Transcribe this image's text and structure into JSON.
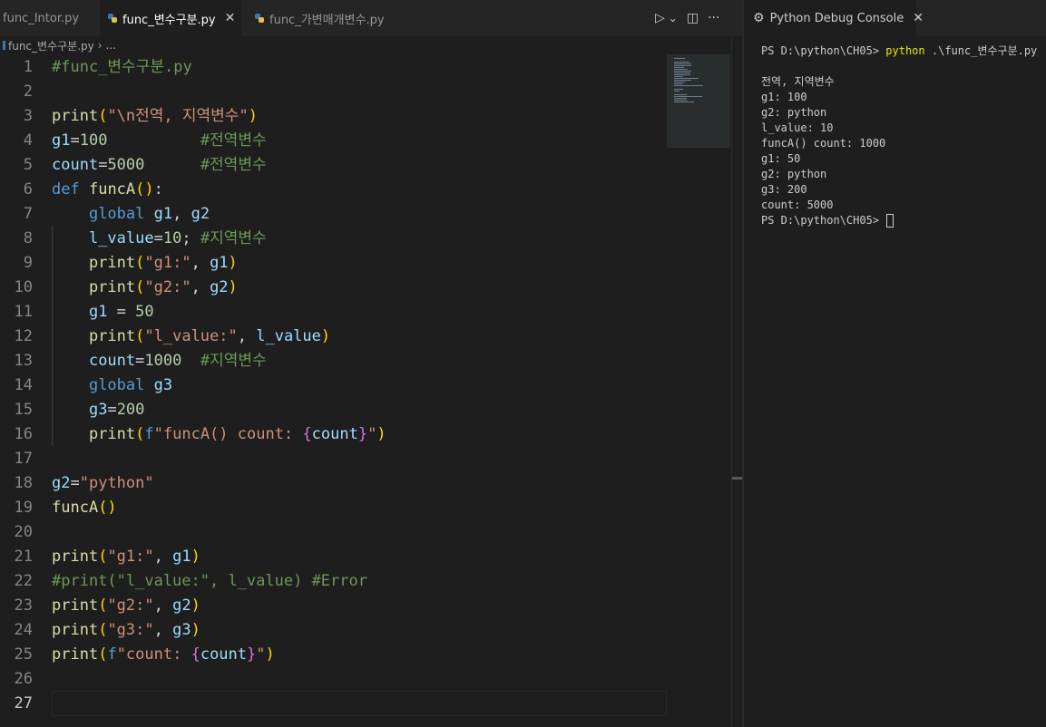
{
  "editor": {
    "tabs": [
      {
        "label": "func_Intor.py",
        "active": false
      },
      {
        "label": "func_변수구분.py",
        "active": true
      },
      {
        "label": "func_가변매개변수.py",
        "active": false
      }
    ],
    "actions": {
      "run": "▷",
      "run_dropdown": "⌄",
      "split": "◫",
      "more": "···"
    },
    "close_glyph": "✕",
    "breadcrumb": {
      "file": "func_변수구분.py",
      "sep": "›",
      "more": "..."
    },
    "current_line": 27
  },
  "panel": {
    "tab_label": "Python Debug Console",
    "close_glyph": "✕",
    "prompt": "PS D:\\python\\CH05>",
    "command": "python",
    "command_arg": ".\\func_변수구분.py",
    "output": [
      "",
      "전역, 지역변수",
      "g1: 100",
      "g2: python",
      "l_value: 10",
      "funcA() count: 1000",
      "g1: 50",
      "g2: python",
      "g3: 200",
      "count: 5000"
    ]
  },
  "colors": {
    "keyword": "#569cd6",
    "function": "#dcdcaa",
    "variable": "#9cdcfe",
    "number": "#b5cea8",
    "string": "#ce9178",
    "comment": "#6a9955",
    "bracket": "#ffd700",
    "bracket_nested": "#da70d6"
  },
  "code": [
    [
      {
        "t": "#func_변수구분.py",
        "c": "cmt"
      }
    ],
    [],
    [
      {
        "t": "print",
        "c": "fn"
      },
      {
        "t": "(",
        "c": "br"
      },
      {
        "t": "\"\\n전역, 지역변수\"",
        "c": "str"
      },
      {
        "t": ")",
        "c": "br"
      }
    ],
    [
      {
        "t": "g1",
        "c": "var"
      },
      {
        "t": "=",
        "c": "op"
      },
      {
        "t": "100",
        "c": "num"
      },
      {
        "t": "          ",
        "c": "op"
      },
      {
        "t": "#전역변수",
        "c": "cmt"
      }
    ],
    [
      {
        "t": "count",
        "c": "var"
      },
      {
        "t": "=",
        "c": "op"
      },
      {
        "t": "5000",
        "c": "num"
      },
      {
        "t": "      ",
        "c": "op"
      },
      {
        "t": "#전역변수",
        "c": "cmt"
      }
    ],
    [
      {
        "t": "def",
        "c": "kw"
      },
      {
        "t": " ",
        "c": "op"
      },
      {
        "t": "funcA",
        "c": "fn"
      },
      {
        "t": "()",
        "c": "br"
      },
      {
        "t": ":",
        "c": "op"
      }
    ],
    [
      {
        "t": "    ",
        "c": "op"
      },
      {
        "t": "global",
        "c": "kw"
      },
      {
        "t": " ",
        "c": "op"
      },
      {
        "t": "g1",
        "c": "var"
      },
      {
        "t": ", ",
        "c": "op"
      },
      {
        "t": "g2",
        "c": "var"
      }
    ],
    [
      {
        "t": "    ",
        "c": "op"
      },
      {
        "t": "l_value",
        "c": "var"
      },
      {
        "t": "=",
        "c": "op"
      },
      {
        "t": "10",
        "c": "num"
      },
      {
        "t": "; ",
        "c": "op"
      },
      {
        "t": "#지역변수",
        "c": "cmt"
      }
    ],
    [
      {
        "t": "    ",
        "c": "op"
      },
      {
        "t": "print",
        "c": "fn"
      },
      {
        "t": "(",
        "c": "br"
      },
      {
        "t": "\"g1:\"",
        "c": "str"
      },
      {
        "t": ", ",
        "c": "op"
      },
      {
        "t": "g1",
        "c": "var"
      },
      {
        "t": ")",
        "c": "br"
      }
    ],
    [
      {
        "t": "    ",
        "c": "op"
      },
      {
        "t": "print",
        "c": "fn"
      },
      {
        "t": "(",
        "c": "br"
      },
      {
        "t": "\"g2:\"",
        "c": "str"
      },
      {
        "t": ", ",
        "c": "op"
      },
      {
        "t": "g2",
        "c": "var"
      },
      {
        "t": ")",
        "c": "br"
      }
    ],
    [
      {
        "t": "    ",
        "c": "op"
      },
      {
        "t": "g1",
        "c": "var"
      },
      {
        "t": " = ",
        "c": "op"
      },
      {
        "t": "50",
        "c": "num"
      }
    ],
    [
      {
        "t": "    ",
        "c": "op"
      },
      {
        "t": "print",
        "c": "fn"
      },
      {
        "t": "(",
        "c": "br"
      },
      {
        "t": "\"l_value:\"",
        "c": "str"
      },
      {
        "t": ", ",
        "c": "op"
      },
      {
        "t": "l_value",
        "c": "var"
      },
      {
        "t": ")",
        "c": "br"
      }
    ],
    [
      {
        "t": "    ",
        "c": "op"
      },
      {
        "t": "count",
        "c": "var"
      },
      {
        "t": "=",
        "c": "op"
      },
      {
        "t": "1000",
        "c": "num"
      },
      {
        "t": "  ",
        "c": "op"
      },
      {
        "t": "#지역변수",
        "c": "cmt"
      }
    ],
    [
      {
        "t": "    ",
        "c": "op"
      },
      {
        "t": "global",
        "c": "kw"
      },
      {
        "t": " ",
        "c": "op"
      },
      {
        "t": "g3",
        "c": "var"
      }
    ],
    [
      {
        "t": "    ",
        "c": "op"
      },
      {
        "t": "g3",
        "c": "var"
      },
      {
        "t": "=",
        "c": "op"
      },
      {
        "t": "200",
        "c": "num"
      }
    ],
    [
      {
        "t": "    ",
        "c": "op"
      },
      {
        "t": "print",
        "c": "fn"
      },
      {
        "t": "(",
        "c": "br"
      },
      {
        "t": "f",
        "c": "kw"
      },
      {
        "t": "\"funcA() count: ",
        "c": "str"
      },
      {
        "t": "{",
        "c": "br2"
      },
      {
        "t": "count",
        "c": "var"
      },
      {
        "t": "}",
        "c": "br2"
      },
      {
        "t": "\"",
        "c": "str"
      },
      {
        "t": ")",
        "c": "br"
      }
    ],
    [],
    [
      {
        "t": "g2",
        "c": "var"
      },
      {
        "t": "=",
        "c": "op"
      },
      {
        "t": "\"python\"",
        "c": "str"
      }
    ],
    [
      {
        "t": "funcA",
        "c": "fn"
      },
      {
        "t": "()",
        "c": "br"
      }
    ],
    [],
    [
      {
        "t": "print",
        "c": "fn"
      },
      {
        "t": "(",
        "c": "br"
      },
      {
        "t": "\"g1:\"",
        "c": "str"
      },
      {
        "t": ", ",
        "c": "op"
      },
      {
        "t": "g1",
        "c": "var"
      },
      {
        "t": ")",
        "c": "br"
      }
    ],
    [
      {
        "t": "#print(\"l_value:\", l_value) #Error",
        "c": "cmt"
      }
    ],
    [
      {
        "t": "print",
        "c": "fn"
      },
      {
        "t": "(",
        "c": "br"
      },
      {
        "t": "\"g2:\"",
        "c": "str"
      },
      {
        "t": ", ",
        "c": "op"
      },
      {
        "t": "g2",
        "c": "var"
      },
      {
        "t": ")",
        "c": "br"
      }
    ],
    [
      {
        "t": "print",
        "c": "fn"
      },
      {
        "t": "(",
        "c": "br"
      },
      {
        "t": "\"g3:\"",
        "c": "str"
      },
      {
        "t": ", ",
        "c": "op"
      },
      {
        "t": "g3",
        "c": "var"
      },
      {
        "t": ")",
        "c": "br"
      }
    ],
    [
      {
        "t": "print",
        "c": "fn"
      },
      {
        "t": "(",
        "c": "br"
      },
      {
        "t": "f",
        "c": "kw"
      },
      {
        "t": "\"count: ",
        "c": "str"
      },
      {
        "t": "{",
        "c": "br2"
      },
      {
        "t": "count",
        "c": "var"
      },
      {
        "t": "}",
        "c": "br2"
      },
      {
        "t": "\"",
        "c": "str"
      },
      {
        "t": ")",
        "c": "br"
      }
    ],
    [],
    []
  ]
}
